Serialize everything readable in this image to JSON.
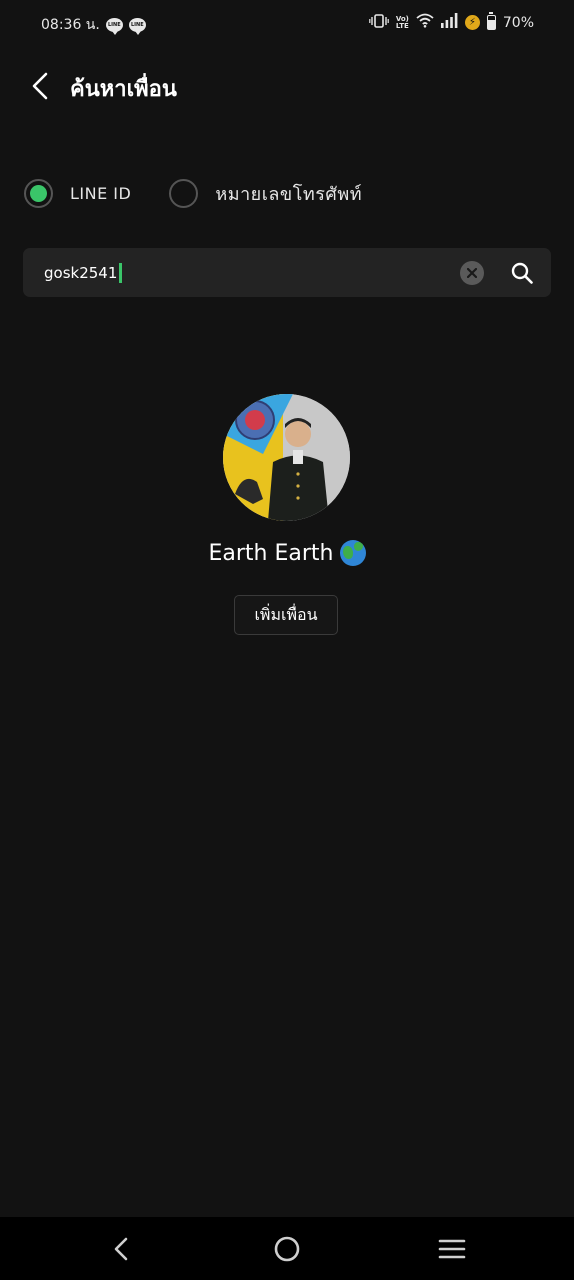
{
  "status_bar": {
    "time": "08:36 น.",
    "notification_app_label": "LINE",
    "network": "LTE",
    "volte": "Vo)",
    "battery_percent": "70%",
    "battery_level": 0.7
  },
  "header": {
    "title": "ค้นหาเพื่อน"
  },
  "search_type": {
    "options": [
      {
        "label": "LINE ID",
        "selected": true
      },
      {
        "label": "หมายเลขโทรศัพท์",
        "selected": false
      }
    ]
  },
  "search": {
    "value": "gosk2541"
  },
  "result": {
    "name": "Earth Earth",
    "add_button_label": "เพิ่มเพื่อน"
  },
  "colors": {
    "background": "#121212",
    "accent": "#3ac569",
    "search_field": "#232323"
  }
}
